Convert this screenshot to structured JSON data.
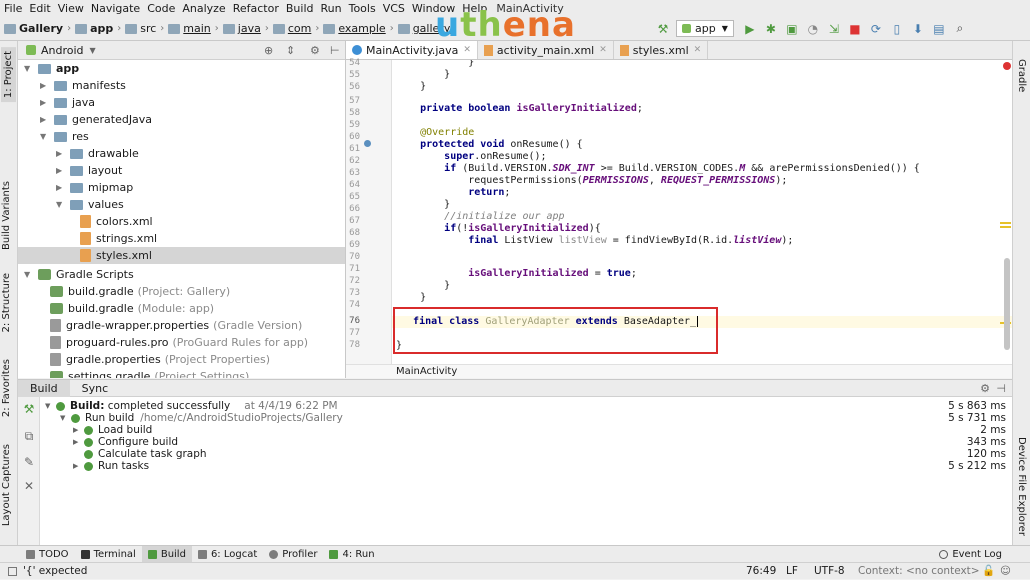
{
  "menu": [
    "File",
    "Edit",
    "View",
    "Navigate",
    "Code",
    "Analyze",
    "Refactor",
    "Build",
    "Run",
    "Tools",
    "VCS",
    "Window",
    "Help"
  ],
  "window_title_fragment": "MainActivity",
  "breadcrumb": [
    "Gallery",
    "app",
    "src",
    "main",
    "java",
    "com",
    "example",
    "gallery"
  ],
  "logo": {
    "text_u": "u",
    "text_th": "th",
    "text_ena": "ena",
    "colors": {
      "u": "#3aa8e0",
      "th": "#8ac24a",
      "ena": "#e8712c"
    }
  },
  "run_config": "app",
  "left_tabs": [
    "1: Project",
    "Build Variants",
    "2: Structure",
    "2: Favorites",
    "Layout Captures"
  ],
  "right_tabs": [
    "Gradle",
    "Device File Explorer"
  ],
  "project": {
    "view": "Android",
    "tree": [
      {
        "label": "app",
        "hint": "",
        "icon": "folder",
        "depth": 0,
        "open": true,
        "bold": true
      },
      {
        "label": "manifests",
        "hint": "",
        "icon": "folder",
        "depth": 1,
        "open": false
      },
      {
        "label": "java",
        "hint": "",
        "icon": "folder",
        "depth": 1,
        "open": false
      },
      {
        "label": "generatedJava",
        "hint": "",
        "icon": "folder",
        "depth": 1,
        "open": false
      },
      {
        "label": "res",
        "hint": "",
        "icon": "folder",
        "depth": 1,
        "open": true
      },
      {
        "label": "drawable",
        "hint": "",
        "icon": "folder",
        "depth": 2,
        "open": false
      },
      {
        "label": "layout",
        "hint": "",
        "icon": "folder",
        "depth": 2,
        "open": false
      },
      {
        "label": "mipmap",
        "hint": "",
        "icon": "folder",
        "depth": 2,
        "open": false
      },
      {
        "label": "values",
        "hint": "",
        "icon": "folder",
        "depth": 2,
        "open": true
      },
      {
        "label": "colors.xml",
        "hint": "",
        "icon": "xml",
        "depth": 3
      },
      {
        "label": "strings.xml",
        "hint": "",
        "icon": "xml",
        "depth": 3
      },
      {
        "label": "styles.xml",
        "hint": "",
        "icon": "xml",
        "depth": 3,
        "selected": true
      },
      {
        "label": "Gradle Scripts",
        "hint": "",
        "icon": "gradle",
        "depth": 0,
        "open": true
      },
      {
        "label": "build.gradle",
        "hint": "(Project: Gallery)",
        "icon": "gradle",
        "depth": 1
      },
      {
        "label": "build.gradle",
        "hint": "(Module: app)",
        "icon": "gradle",
        "depth": 1
      },
      {
        "label": "gradle-wrapper.properties",
        "hint": "(Gradle Version)",
        "icon": "file",
        "depth": 1
      },
      {
        "label": "proguard-rules.pro",
        "hint": "(ProGuard Rules for app)",
        "icon": "file",
        "depth": 1
      },
      {
        "label": "gradle.properties",
        "hint": "(Project Properties)",
        "icon": "file",
        "depth": 1
      },
      {
        "label": "settings.gradle",
        "hint": "(Project Settings)",
        "icon": "gradle",
        "depth": 1
      }
    ]
  },
  "tabs": [
    {
      "label": "MainActivity.java",
      "icon": "java",
      "active": true
    },
    {
      "label": "activity_main.xml",
      "icon": "xml",
      "active": false
    },
    {
      "label": "styles.xml",
      "icon": "xml",
      "active": false
    }
  ],
  "editor": {
    "line_numbers": [
      "54",
      "55",
      "56",
      "57",
      "58",
      "59",
      "60",
      "61",
      "62",
      "63",
      "64",
      "65",
      "66",
      "67",
      "68",
      "69",
      "70",
      "71",
      "72",
      "73",
      "74",
      "75",
      "76",
      "77",
      "78"
    ],
    "breadcrumb": "MainActivity"
  },
  "build": {
    "tabs": [
      "Build",
      "Sync"
    ],
    "rows": [
      {
        "label": "Build:",
        "extra": "completed successfully",
        "time": "at 4/4/19 6:22 PM",
        "duration": "5 s 863 ms",
        "depth": 0
      },
      {
        "label": "Run build",
        "extra": "/home/c/AndroidStudioProjects/Gallery",
        "time": "",
        "duration": "5 s 731 ms",
        "depth": 1
      },
      {
        "label": "Load build",
        "extra": "",
        "time": "",
        "duration": "2 ms",
        "depth": 2
      },
      {
        "label": "Configure build",
        "extra": "",
        "time": "",
        "duration": "343 ms",
        "depth": 2
      },
      {
        "label": "Calculate task graph",
        "extra": "",
        "time": "",
        "duration": "120 ms",
        "depth": 2
      },
      {
        "label": "Run tasks",
        "extra": "",
        "time": "",
        "duration": "5 s 212 ms",
        "depth": 2
      }
    ]
  },
  "toolwindows": [
    "TODO",
    "Terminal",
    "Build",
    "6: Logcat",
    "Profiler",
    "4: Run"
  ],
  "event_log": "Event Log",
  "status": {
    "message": "'{' expected",
    "position": "76:49",
    "line_sep": "LF",
    "encoding": "UTF-8",
    "context": "Context: <no context>"
  }
}
